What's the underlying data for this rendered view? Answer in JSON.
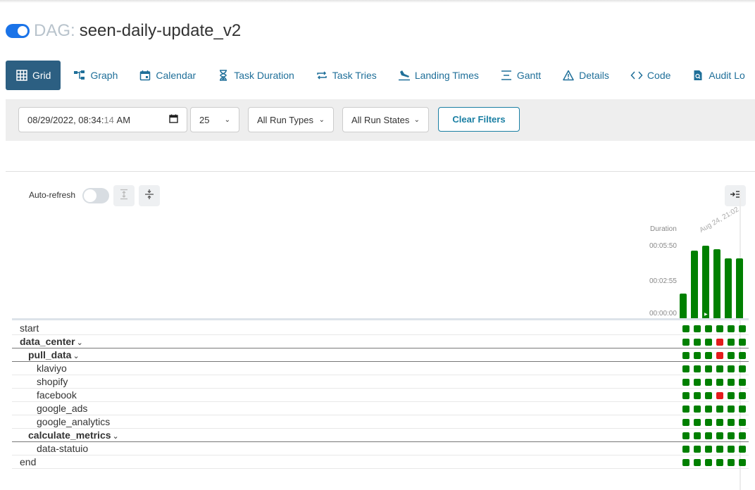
{
  "dag": {
    "label": "DAG:",
    "name": "seen-daily-update_v2",
    "paused": false
  },
  "tabs": [
    {
      "label": "Grid",
      "icon": "grid-icon",
      "active": true
    },
    {
      "label": "Graph",
      "icon": "graph-icon"
    },
    {
      "label": "Calendar",
      "icon": "calendar-icon"
    },
    {
      "label": "Task Duration",
      "icon": "hourglass-icon"
    },
    {
      "label": "Task Tries",
      "icon": "repeat-icon"
    },
    {
      "label": "Landing Times",
      "icon": "plane-landing-icon"
    },
    {
      "label": "Gantt",
      "icon": "gantt-icon"
    },
    {
      "label": "Details",
      "icon": "warning-triangle-icon"
    },
    {
      "label": "Code",
      "icon": "code-icon"
    },
    {
      "label": "Audit Lo",
      "icon": "audit-log-icon"
    }
  ],
  "filters": {
    "date_main": "08/29/2022, 08:34:",
    "date_seconds": "14",
    "date_ampm": "AM",
    "num_runs": "25",
    "run_types": "All Run Types",
    "run_states": "All Run States",
    "clear_label": "Clear Filters"
  },
  "grid": {
    "auto_refresh_label": "Auto-refresh",
    "duration_label": "Duration",
    "run_date_label": "Aug 24, 21:02",
    "ticks": [
      "00:05:50",
      "00:02:55",
      "00:00:00"
    ]
  },
  "chart_data": {
    "type": "bar",
    "ylabel": "Duration",
    "y_ticks": [
      "00:00:00",
      "00:02:55",
      "00:05:50"
    ],
    "values_seconds": [
      120,
      330,
      355,
      335,
      290,
      290
    ],
    "color": "#008000"
  },
  "tasks": [
    {
      "name": "start",
      "level": 0,
      "group": false,
      "states": [
        "s",
        "s",
        "s",
        "s",
        "s",
        "s"
      ]
    },
    {
      "name": "data_center",
      "level": 0,
      "group": true,
      "states": [
        "s",
        "s",
        "s",
        "f",
        "s",
        "s"
      ]
    },
    {
      "name": "pull_data",
      "level": 1,
      "group": true,
      "states": [
        "s",
        "s",
        "s",
        "f",
        "s",
        "s"
      ]
    },
    {
      "name": "klaviyo",
      "level": 2,
      "group": false,
      "states": [
        "s",
        "s",
        "s",
        "s",
        "s",
        "s"
      ]
    },
    {
      "name": "shopify",
      "level": 2,
      "group": false,
      "states": [
        "s",
        "s",
        "s",
        "s",
        "s",
        "s"
      ]
    },
    {
      "name": "facebook",
      "level": 2,
      "group": false,
      "states": [
        "s",
        "s",
        "s",
        "f",
        "s",
        "s"
      ]
    },
    {
      "name": "google_ads",
      "level": 2,
      "group": false,
      "states": [
        "s",
        "s",
        "s",
        "s",
        "s",
        "s"
      ]
    },
    {
      "name": "google_analytics",
      "level": 2,
      "group": false,
      "states": [
        "s",
        "s",
        "s",
        "s",
        "s",
        "s"
      ]
    },
    {
      "name": "calculate_metrics",
      "level": 1,
      "group": true,
      "states": [
        "s",
        "s",
        "s",
        "s",
        "s",
        "s"
      ]
    },
    {
      "name": "data-statuio",
      "level": 2,
      "group": false,
      "states": [
        "s",
        "s",
        "s",
        "s",
        "s",
        "s"
      ]
    },
    {
      "name": "end",
      "level": 0,
      "group": false,
      "states": [
        "s",
        "s",
        "s",
        "s",
        "s",
        "s"
      ]
    }
  ],
  "colors": {
    "success": "#008000",
    "failed": "#e31b1b",
    "accent": "#1f6f99",
    "active_tab": "#2c5f82"
  }
}
